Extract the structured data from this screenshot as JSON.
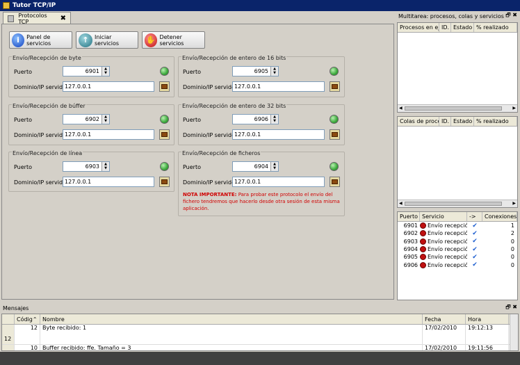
{
  "window": {
    "title": "Tutor TCP/IP"
  },
  "tab": {
    "label": "Protocolos TCP",
    "close": "✖"
  },
  "toolbar": {
    "panel": "Panel de servicios",
    "start": "Iniciar servicios",
    "stop": "Detener servicios"
  },
  "labels": {
    "port": "Puerto",
    "domain": "Dominio/IP servidor"
  },
  "groups": [
    {
      "title": "Envío/Recepción de byte",
      "port": "6901",
      "host": "127.0.0.1"
    },
    {
      "title": "Envío/Recepción de entero de 16 bits",
      "port": "6905",
      "host": "127.0.0.1"
    },
    {
      "title": "Envío/Recepción de búffer",
      "port": "6902",
      "host": "127.0.0.1"
    },
    {
      "title": "Envío/Recepción de entero de 32 bits",
      "port": "6906",
      "host": "127.0.0.1"
    },
    {
      "title": "Envío/Recepción de línea",
      "port": "6903",
      "host": "127.0.0.1"
    },
    {
      "title": "Envío/Recepción de ficheros",
      "port": "6904",
      "host": "127.0.0.1"
    }
  ],
  "note": {
    "strong": "NOTA IMPORTANTE:",
    "text": " Para probar este protocolo el envío del fichero tendremos que hacerlo desde otra sesión de esta misma aplicación."
  },
  "dock": {
    "title": "Multitarea: procesos, colas y servicios",
    "dock_buttons": "🗗 ✖",
    "processes": {
      "headers": [
        "Procesos en ejec",
        "ID.",
        "Estado",
        "% realizado"
      ]
    },
    "queues": {
      "headers": [
        "Colas de proceso",
        "ID.",
        "Estado",
        "% realizado"
      ]
    },
    "services": {
      "headers": [
        "Puerto",
        "Servicio",
        "->",
        "Conexiones"
      ],
      "rows": [
        {
          "port": "6901",
          "service": "Envío recepció...",
          "conn": "1"
        },
        {
          "port": "6902",
          "service": "Envío recepció...",
          "conn": "2"
        },
        {
          "port": "6903",
          "service": "Envío recepció...",
          "conn": "0"
        },
        {
          "port": "6904",
          "service": "Envío recepció...",
          "conn": "0"
        },
        {
          "port": "6905",
          "service": "Envío recepció...",
          "conn": "0"
        },
        {
          "port": "6906",
          "service": "Envío recepció...",
          "conn": "0"
        }
      ]
    }
  },
  "messages": {
    "title": "Mensajes",
    "dock_buttons": "🗗 ✖",
    "headers": {
      "code": "Códig",
      "name": "Nombre",
      "date": "Fecha",
      "time": "Hora"
    },
    "row_number": "12",
    "rows": [
      {
        "code": "12",
        "name": "Byte recibido: 1",
        "date": "17/02/2010",
        "time": "19:12:13"
      },
      {
        "code": "10",
        "name": "Buffer recibido: ffe. Tamaño = 3",
        "date": "17/02/2010",
        "time": "19:11:56"
      }
    ]
  }
}
